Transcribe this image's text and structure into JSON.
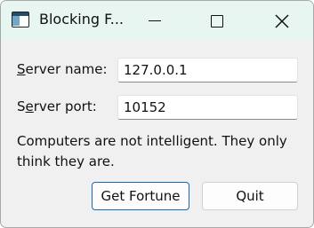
{
  "window": {
    "title": "Blocking F...",
    "icon": "app-window-icon",
    "controls": [
      "minimize-icon",
      "maximize-icon",
      "close-icon"
    ]
  },
  "form": {
    "server_name": {
      "label_first": "S",
      "label_rest": "erver name:",
      "value": "127.0.0.1"
    },
    "server_port": {
      "label_first": "S",
      "label_u": "e",
      "label_rest": "rver port:",
      "value": "10152"
    }
  },
  "status_text": "Computers are not intelligent. They only think they are.",
  "buttons": {
    "get_fortune": "Get Fortune",
    "quit": "Quit"
  },
  "colors": {
    "titlebar": "#e8f6f1",
    "window_bg": "#f0f0f0",
    "focus_border": "#1a67b3"
  }
}
